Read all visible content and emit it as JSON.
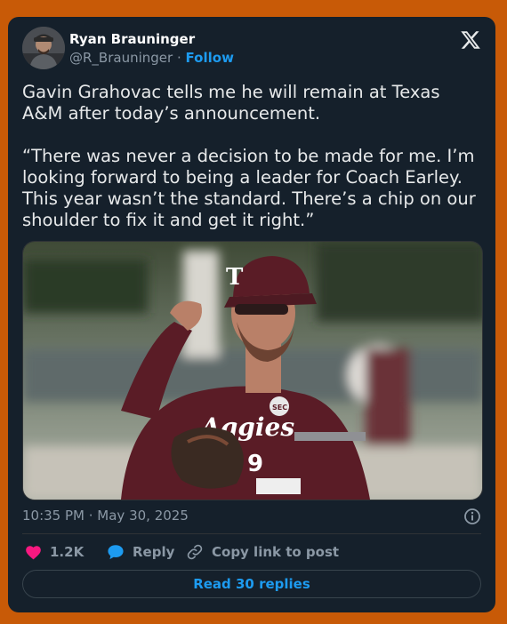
{
  "author": {
    "name": "Ryan Brauninger",
    "handle": "@R_Brauninger",
    "separator": "·",
    "follow_label": "Follow"
  },
  "tweet": {
    "text": "Gavin Grahovac tells me he will remain at Texas A&M after today’s announcement.\n\n“There was never a decision to be made for me. I’m looking forward to being a leader for Coach Earley. This year wasn’t the standard. There’s a chip on our shoulder to fix it and get it right.”",
    "timestamp": "10:35 PM · May 30, 2025"
  },
  "media": {
    "cap_letter": "T",
    "jersey_script": "Aggies",
    "jersey_number": "9",
    "patch_text": "SEC"
  },
  "actions": {
    "likes": "1.2K",
    "reply_label": "Reply",
    "copy_label": "Copy link to post",
    "read_replies_label": "Read 30 replies"
  },
  "colors": {
    "background": "#c85a07",
    "card": "#15202b",
    "accent": "#1d9bf0",
    "like": "#f91880",
    "text_primary": "#e7e9ea",
    "text_secondary": "#8b98a5"
  },
  "icons": [
    "x-logo-icon",
    "info-icon",
    "heart-icon",
    "reply-bubble-icon",
    "link-icon"
  ]
}
